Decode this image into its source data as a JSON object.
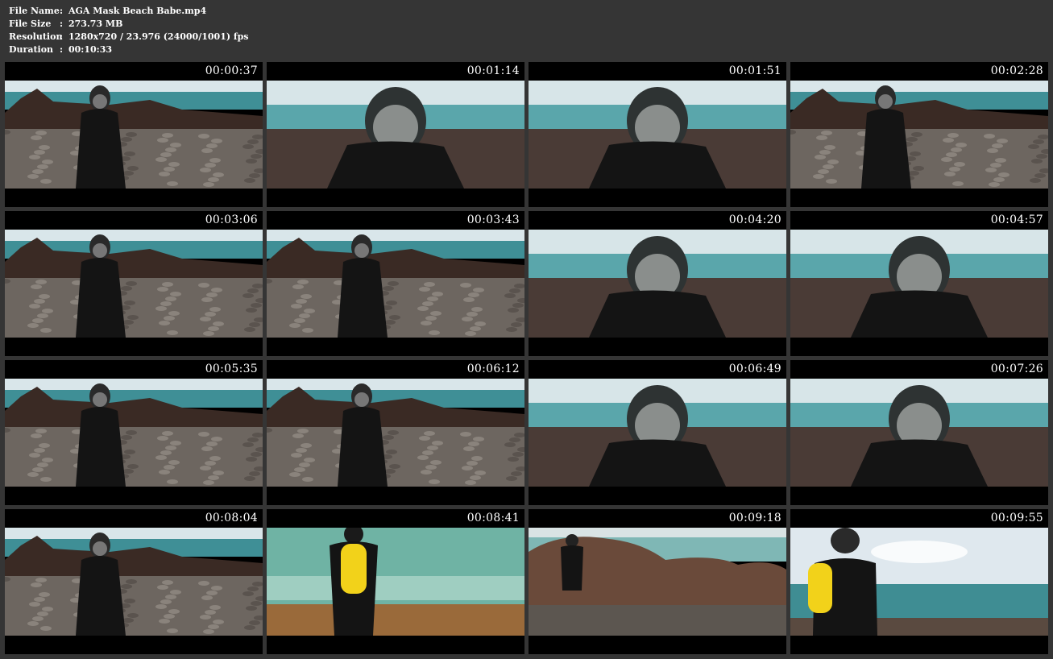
{
  "file_info": {
    "rows": [
      {
        "label": "File Name",
        "sep": ":",
        "value": "AGA Mask Beach Babe.mp4"
      },
      {
        "label": "File Size",
        "sep": ":",
        "value": "273.73 MB"
      },
      {
        "label": "Resolution",
        "sep": ":",
        "value": "1280x720 / 23.976 (24000/1001) fps"
      },
      {
        "label": "Duration",
        "sep": ":",
        "value": "00:10:33"
      }
    ]
  },
  "thumbnails": [
    {
      "timestamp": "00:00:37",
      "scene": "rocks-wide"
    },
    {
      "timestamp": "00:01:14",
      "scene": "close-blur"
    },
    {
      "timestamp": "00:01:51",
      "scene": "close-blur"
    },
    {
      "timestamp": "00:02:28",
      "scene": "rocks-wide"
    },
    {
      "timestamp": "00:03:06",
      "scene": "rocks-wide"
    },
    {
      "timestamp": "00:03:43",
      "scene": "rocks-wide"
    },
    {
      "timestamp": "00:04:20",
      "scene": "close-blur"
    },
    {
      "timestamp": "00:04:57",
      "scene": "close-blur"
    },
    {
      "timestamp": "00:05:35",
      "scene": "rocks-wide"
    },
    {
      "timestamp": "00:06:12",
      "scene": "rocks-wide"
    },
    {
      "timestamp": "00:06:49",
      "scene": "close-blur"
    },
    {
      "timestamp": "00:07:26",
      "scene": "close-blur"
    },
    {
      "timestamp": "00:08:04",
      "scene": "rocks-wide"
    },
    {
      "timestamp": "00:08:41",
      "scene": "tank-back"
    },
    {
      "timestamp": "00:09:18",
      "scene": "boulders"
    },
    {
      "timestamp": "00:09:55",
      "scene": "tank-side"
    }
  ],
  "colors": {
    "background": "#353535",
    "text": "#ffffff",
    "sea": "#3f8f96",
    "sky": "#d9e6ea",
    "suit": "#141414",
    "tank": "#f2d21a"
  }
}
